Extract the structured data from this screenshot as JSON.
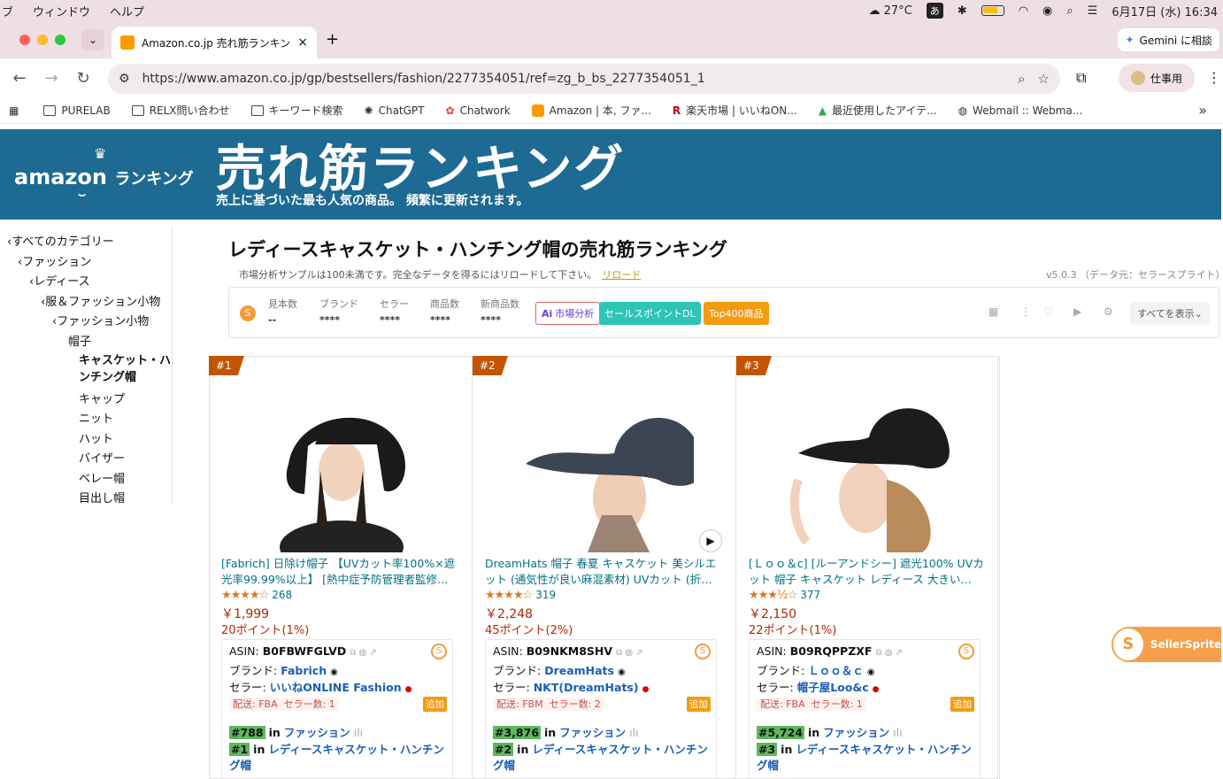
{
  "menubar": {
    "items": [
      "ブ",
      "ウィンドウ",
      "ヘルプ"
    ],
    "weather": "27°C",
    "ime": "あ",
    "datetime": "6月17日 (水) 16:34"
  },
  "tab": {
    "title": "Amazon.co.jp 売れ筋ランキング",
    "close": "×",
    "new": "+"
  },
  "gemini_label": "Gemini に相談",
  "url": "https://www.amazon.co.jp/gp/bestsellers/fashion/2277354051/ref=zg_b_bs_2277354051_1",
  "profile_label": "仕事用",
  "bookmarks": [
    {
      "label": "PURELAB",
      "icon": "folder-icon"
    },
    {
      "label": "RELX問い合わせ",
      "icon": "folder-icon"
    },
    {
      "label": "キーワード検索",
      "icon": "folder-icon"
    },
    {
      "label": "ChatGPT",
      "icon": "chatgpt-icon"
    },
    {
      "label": "Chatwork",
      "icon": "chatwork-icon"
    },
    {
      "label": "Amazon | 本, ファ...",
      "icon": "amazon-icon"
    },
    {
      "label": "楽天市場 | いいねON...",
      "icon": "rakuten-icon"
    },
    {
      "label": "最近使用したアイテ...",
      "icon": "drive-icon"
    },
    {
      "label": "Webmail :: Webma...",
      "icon": "globe-icon"
    }
  ],
  "banner": {
    "logo_amazon": "amazon",
    "logo_ranking": "ランキング",
    "title": "売れ筋ランキング",
    "subtitle": "売上に基づいた最も人気の商品。 頻繁に更新されます。"
  },
  "sidebar": {
    "items": [
      "‹すべてのカテゴリー",
      "‹ファッション",
      "‹レディース",
      "‹服＆ファッション小物",
      "‹ファッション小物",
      "帽子",
      "キャスケット・ハ",
      "ンチング帽",
      "キャップ",
      "ニット",
      "ハット",
      "バイザー",
      "ベレー帽",
      "目出し帽"
    ]
  },
  "page_title": "レディースキャスケット・ハンチング帽の売れ筋ランキング",
  "notice": {
    "text": "市場分析サンプルは100未満です。完全なデータを得るにはリロードして下さい。",
    "link": "リロード"
  },
  "version": "v5.0.3 （データ元：セラースプライト）",
  "stats": {
    "items": [
      {
        "label": "見本数",
        "value": "--"
      },
      {
        "label": "ブランド",
        "value": "****"
      },
      {
        "label": "セラー",
        "value": "****"
      },
      {
        "label": "商品数",
        "value": "****"
      },
      {
        "label": "新商品数",
        "value": "****"
      }
    ],
    "btn_market": "市場分析",
    "btn_sales": "セールスポイントDL",
    "btn_top400": "Top400商品",
    "show_all": "すべてを表示"
  },
  "products": [
    {
      "rank": "#1",
      "title": "[Fabrich] 日除け帽子 【UVカット率100%×遮光率99.99%以上】 [熱中症予防管理者監修…",
      "stars": "★★★★☆",
      "reviews": "268",
      "rating": 4.0,
      "price": "￥1,999",
      "points": "20ポイント(1%)",
      "asin_label": "ASIN: ",
      "asin": "B0FBWFGLVD",
      "brand_label": "ブランド: ",
      "brand": "Fabrich",
      "seller_label": "セラー: ",
      "seller": "いいねONLINE Fashion",
      "ship": "配送: FBA",
      "sellers": "セラー数: 1",
      "add": "追加",
      "rank1": "#788",
      "cat1": "ファッション",
      "rank2": "#1",
      "cat2": "レディースキャスケット・ハンチング帽",
      "hat_color": "#1a1a1a"
    },
    {
      "rank": "#2",
      "title": "DreamHats 帽子 春夏 キャスケット 美シルエット (通気性が良い麻混素材) UVカット (折…",
      "stars": "★★★★☆",
      "reviews": "319",
      "rating": 4.0,
      "price": "￥2,248",
      "points": "45ポイント(2%)",
      "asin_label": "ASIN: ",
      "asin": "B09NKM8SHV",
      "brand_label": "ブランド: ",
      "brand": "DreamHats",
      "seller_label": "セラー: ",
      "seller": "NKT(DreamHats)",
      "ship": "配送: FBM",
      "sellers": "セラー数: 2",
      "add": "追加",
      "rank1": "#3,876",
      "cat1": "ファッション",
      "rank2": "#2",
      "cat2": "レディースキャスケット・ハンチング帽",
      "hat_color": "#3c4553"
    },
    {
      "rank": "#3",
      "title": "[Ｌｏｏ＆c] [ルーアンドシー] 遮光100% UVカット 帽子 キャスケット レディース 大きい…",
      "stars": "★★★½☆",
      "reviews": "377",
      "rating": 3.5,
      "price": "￥2,150",
      "points": "22ポイント(1%)",
      "asin_label": "ASIN: ",
      "asin": "B09RQPPZXF",
      "brand_label": "ブランド: ",
      "brand": "Ｌｏｏ＆ｃ",
      "seller_label": "セラー: ",
      "seller": "帽子屋Loo&c",
      "ship": "配送: FBA",
      "sellers": "セラー数: 1",
      "add": "追加",
      "rank1": "#5,724",
      "cat1": "ファッション",
      "rank2": "#3",
      "cat2": "レディースキャスケット・ハンチング帽",
      "hat_color": "#1c1c1c"
    }
  ],
  "in_label": "in",
  "sellersprite_label": "SellerSprite",
  "colors": {
    "banner": "#1d6a92",
    "rank_badge": "#c45500",
    "link": "#007185",
    "price": "#b12704",
    "star": "#de7921"
  }
}
